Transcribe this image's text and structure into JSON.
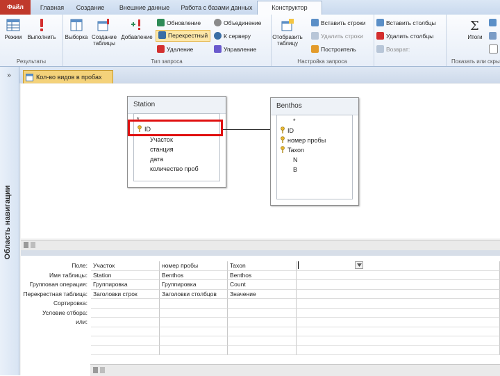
{
  "tabs": {
    "file": "Файл",
    "home": "Главная",
    "create": "Создание",
    "external": "Внешние данные",
    "database": "Работа с базами данных",
    "design": "Конструктор"
  },
  "ribbon": {
    "results": {
      "label": "Результаты",
      "view": "Режим",
      "run": "Выполнить"
    },
    "query_type": {
      "label": "Тип запроса",
      "select": "Выборка",
      "make_table": "Создание таблицы",
      "append": "Добавление",
      "update": "Обновление",
      "crosstab": "Перекрестный",
      "delete": "Удаление",
      "union": "Объединение",
      "pass_through": "К серверу",
      "data_definition": "Управление"
    },
    "setup": {
      "label": "Настройка запроса",
      "show_table": "Отобразить таблицу",
      "insert_rows": "Вставить строки",
      "delete_rows": "Удалить строки",
      "builder": "Построитель",
      "insert_columns": "Вставить столбцы",
      "delete_columns": "Удалить столбцы",
      "return": "Возврат:"
    },
    "show_hide": {
      "label": "Показать или скрыть",
      "totals": "Итоги"
    }
  },
  "nav": {
    "toggle": "»",
    "label": "Область навигации"
  },
  "doc_tab": "Кол-во видов в пробах",
  "tables": {
    "station": {
      "title": "Station",
      "fields": [
        "*",
        "ID",
        "Участок",
        "станция",
        "дата",
        "количество проб"
      ],
      "key_fields": [
        "ID"
      ]
    },
    "benthos": {
      "title": "Benthos",
      "fields": [
        "*",
        "ID",
        "номер пробы",
        "Taxon",
        "N",
        "B"
      ],
      "key_fields": [
        "ID",
        "номер пробы",
        "Taxon"
      ]
    }
  },
  "grid": {
    "row_labels": [
      "Поле:",
      "Имя таблицы:",
      "Групповая операция:",
      "Перекрестная таблица:",
      "Сортировка:",
      "Условие отбора:",
      "или:"
    ],
    "columns": [
      [
        "Участок",
        "Station",
        "Группировка",
        "Заголовки строк",
        "",
        "",
        ""
      ],
      [
        "номер пробы",
        "Benthos",
        "Группировка",
        "Заголовки столбцов",
        "",
        "",
        ""
      ],
      [
        "Taxon",
        "Benthos",
        "Count",
        "Значение",
        "",
        "",
        ""
      ]
    ]
  }
}
